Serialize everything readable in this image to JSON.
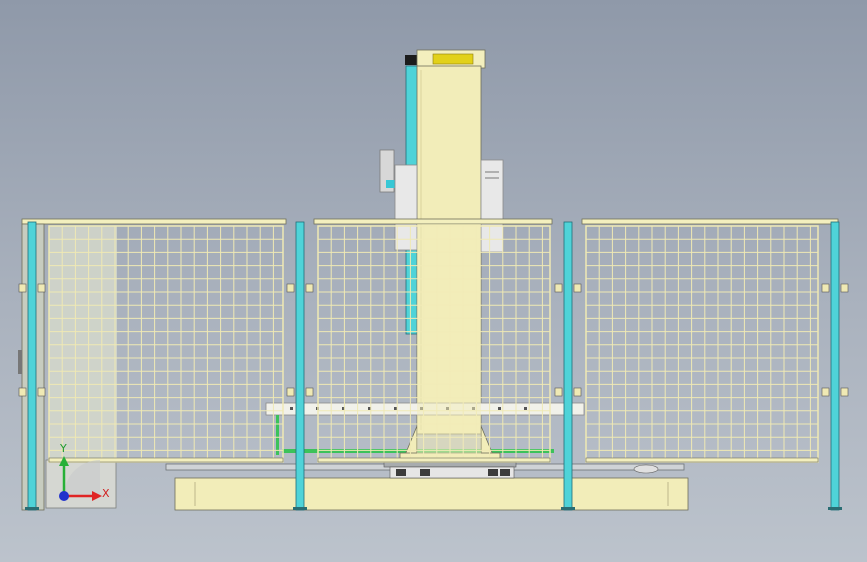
{
  "scene": {
    "view": "front",
    "background_top": "#8f99a9",
    "background_bottom": "#bcc3cc"
  },
  "colors": {
    "frame": "#f3efbe",
    "frame_stroke": "#6f6f5a",
    "mesh": "#efe9b4",
    "post": "#4fd3d8",
    "post_stroke": "#1f6f78",
    "column": "#f2edb9",
    "green_rail": "#3cc25a",
    "door_panel": "#d7dbcc"
  },
  "triad": {
    "x_label": "X",
    "y_label": "Y",
    "x_color": "#e02424",
    "y_color": "#27b037",
    "z_color": "#2233cc"
  }
}
